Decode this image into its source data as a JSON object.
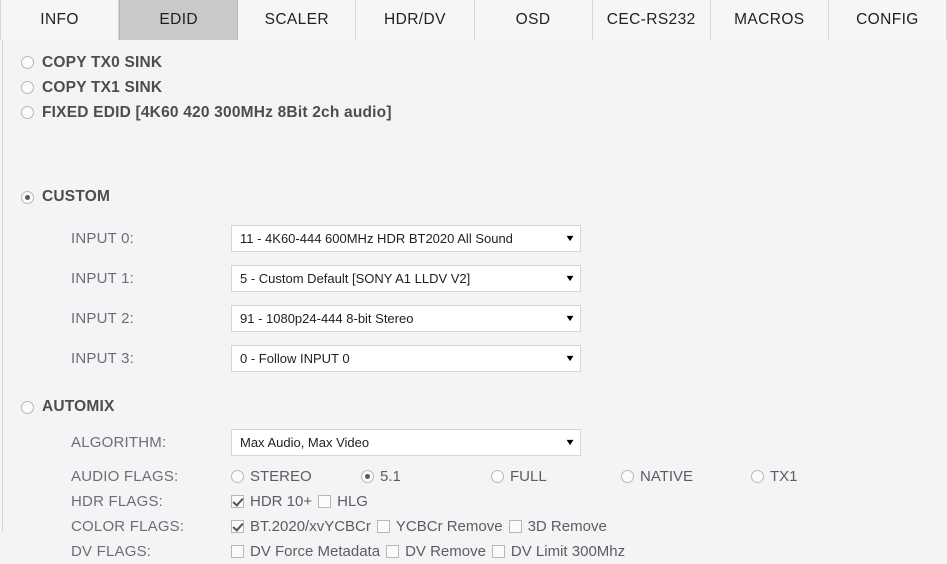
{
  "tabs": [
    {
      "label": "INFO",
      "active": false
    },
    {
      "label": "EDID",
      "active": true
    },
    {
      "label": "SCALER",
      "active": false
    },
    {
      "label": "HDR/DV",
      "active": false
    },
    {
      "label": "OSD",
      "active": false
    },
    {
      "label": "CEC-RS232",
      "active": false
    },
    {
      "label": "MACROS",
      "active": false
    },
    {
      "label": "CONFIG",
      "active": false
    }
  ],
  "modes": [
    {
      "label": "COPY TX0 SINK",
      "selected": false
    },
    {
      "label": "COPY TX1 SINK",
      "selected": false
    },
    {
      "label": "FIXED EDID [4K60 420 300MHz 8Bit 2ch audio]",
      "selected": false
    }
  ],
  "custom": {
    "label": "CUSTOM",
    "selected": true,
    "inputs": [
      {
        "label": "INPUT 0:",
        "value": "11 - 4K60-444 600MHz HDR BT2020 All Sound"
      },
      {
        "label": "INPUT 1:",
        "value": "5 - Custom Default [SONY A1 LLDV V2]"
      },
      {
        "label": "INPUT 2:",
        "value": "91 - 1080p24-444 8-bit Stereo"
      },
      {
        "label": "INPUT 3:",
        "value": "0 - Follow INPUT 0"
      }
    ]
  },
  "automix": {
    "label": "AUTOMIX",
    "selected": false,
    "algorithm": {
      "label": "ALGORITHM:",
      "value": "Max Audio, Max Video"
    },
    "audio_flags": {
      "label": "AUDIO FLAGS:",
      "options": [
        {
          "label": "STEREO",
          "selected": false
        },
        {
          "label": "5.1",
          "selected": true
        },
        {
          "label": "FULL",
          "selected": false
        },
        {
          "label": "NATIVE",
          "selected": false
        },
        {
          "label": "TX1",
          "selected": false
        }
      ]
    },
    "hdr_flags": {
      "label": "HDR FLAGS:",
      "options": [
        {
          "label": "HDR 10+",
          "checked": true
        },
        {
          "label": "HLG",
          "checked": false
        }
      ]
    },
    "color_flags": {
      "label": "COLOR FLAGS:",
      "options": [
        {
          "label": "BT.2020/xvYCBCr",
          "checked": true
        },
        {
          "label": "YCBCr Remove",
          "checked": false
        },
        {
          "label": "3D Remove",
          "checked": false
        }
      ]
    },
    "dv_flags": {
      "label": "DV FLAGS:",
      "options": [
        {
          "label": "DV Force Metadata",
          "checked": false
        },
        {
          "label": "DV Remove",
          "checked": false
        },
        {
          "label": "DV Limit 300Mhz",
          "checked": false
        }
      ]
    }
  },
  "colors": {
    "background": "#f4f3f5",
    "active_tab": "#c9c9c9",
    "tab": "#f6f5f7",
    "bold_label": "#4d4d4d",
    "field_label": "#6e6e72",
    "select_bg": "#ffffff",
    "border": "#d6d5d8"
  },
  "icons": {
    "dropdown": "▼"
  }
}
